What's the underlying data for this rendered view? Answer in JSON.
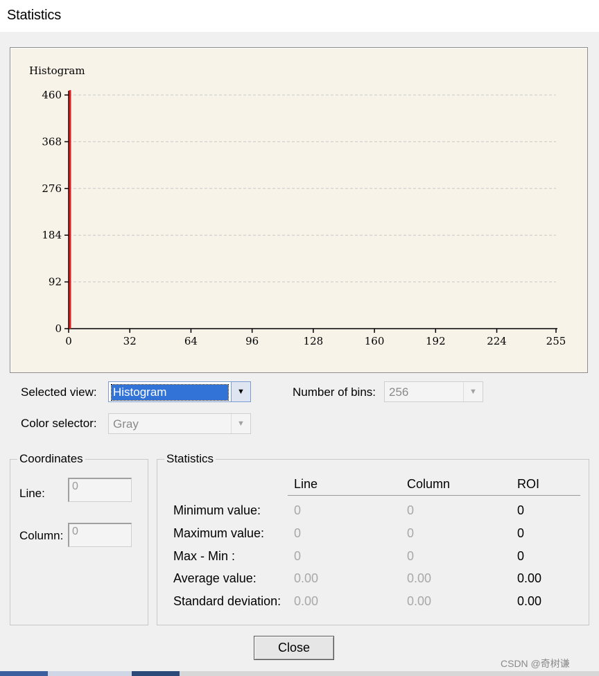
{
  "window": {
    "title": "Statistics"
  },
  "chart_data": {
    "type": "bar",
    "title": "Histogram",
    "xlabel": "",
    "ylabel": "",
    "xlim": [
      0,
      255
    ],
    "ylim": [
      0,
      460
    ],
    "x_ticks": [
      0,
      32,
      64,
      96,
      128,
      160,
      192,
      224,
      255
    ],
    "y_ticks": [
      0,
      92,
      184,
      276,
      368,
      460
    ],
    "grid": true,
    "series": [
      {
        "color": "#e02020",
        "x": [
          0
        ],
        "values": [
          460
        ]
      }
    ]
  },
  "controls": {
    "selected_view_label": "Selected view:",
    "selected_view_value": "Histogram",
    "num_bins_label": "Number of bins:",
    "num_bins_value": "256",
    "color_selector_label": "Color selector:",
    "color_selector_value": "Gray"
  },
  "coordinates": {
    "legend": "Coordinates",
    "line_label": "Line:",
    "line_value": "0",
    "column_label": "Column:",
    "column_value": "0"
  },
  "statistics": {
    "legend": "Statistics",
    "headers": [
      "Line",
      "Column",
      "ROI"
    ],
    "rows": [
      {
        "label": "Minimum value:",
        "line": "0",
        "column": "0",
        "roi": "0"
      },
      {
        "label": "Maximum value:",
        "line": "0",
        "column": "0",
        "roi": "0"
      },
      {
        "label": "Max - Min :",
        "line": "0",
        "column": "0",
        "roi": "0"
      },
      {
        "label": "Average value:",
        "line": "0.00",
        "column": "0.00",
        "roi": "0.00"
      },
      {
        "label": "Standard deviation:",
        "line": "0.00",
        "column": "0.00",
        "roi": "0.00"
      }
    ]
  },
  "buttons": {
    "close": "Close"
  },
  "watermark": "CSDN @奇树谦",
  "colors": {
    "selection": "#3173d7",
    "chart_bg": "#f7f3e8",
    "histogram": "#e02020"
  }
}
